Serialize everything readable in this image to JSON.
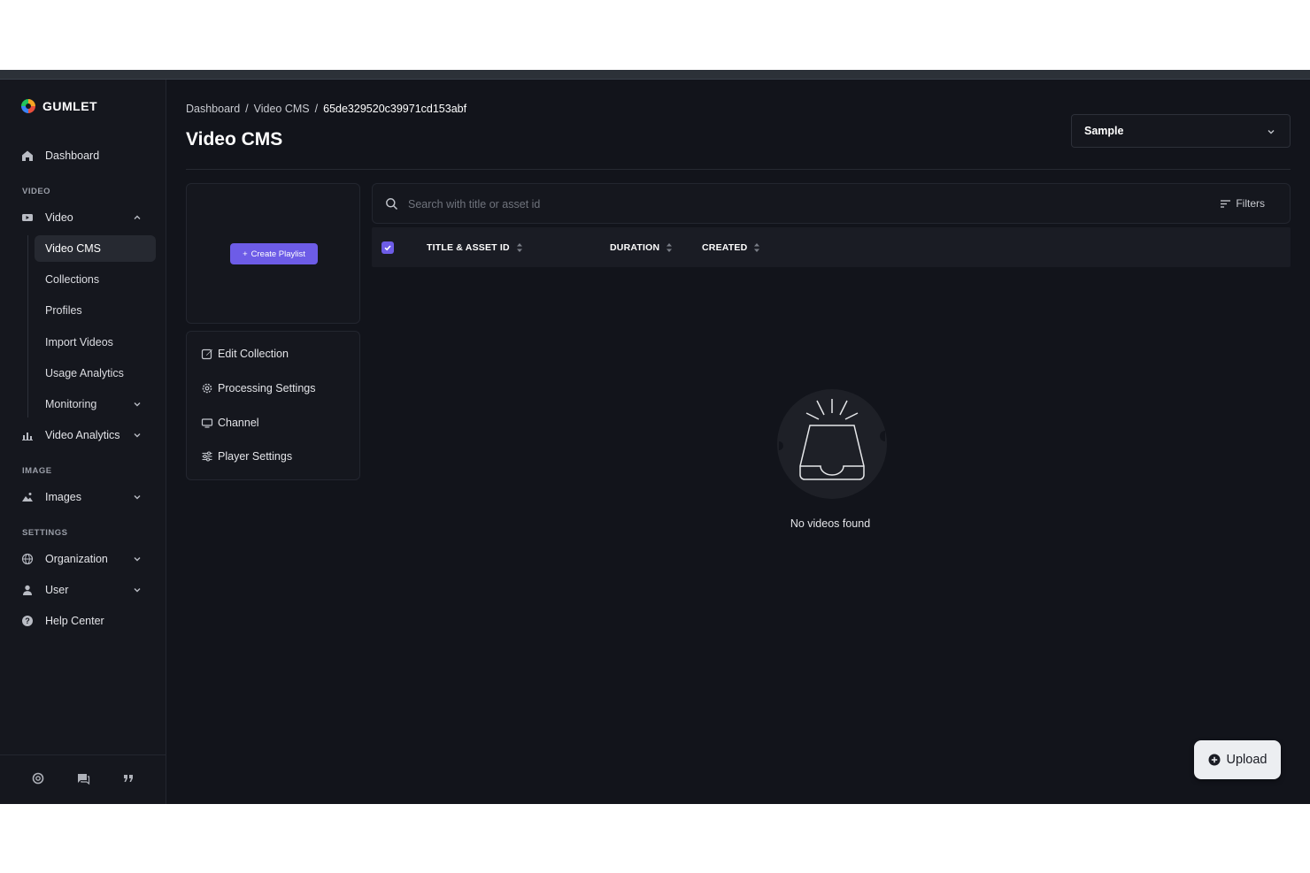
{
  "brand": {
    "name": "GUMLET"
  },
  "sidebar": {
    "dashboard": "Dashboard",
    "sections": {
      "video": "VIDEO",
      "image": "IMAGE",
      "settings": "SETTINGS"
    },
    "video": {
      "label": "Video",
      "items": [
        "Video CMS",
        "Collections",
        "Profiles",
        "Import Videos",
        "Usage Analytics",
        "Monitoring"
      ]
    },
    "video_analytics": "Video Analytics",
    "images": "Images",
    "organization": "Organization",
    "user": "User",
    "help_center": "Help Center"
  },
  "breadcrumb": {
    "home": "Dashboard",
    "section": "Video CMS",
    "current": "65de329520c39971cd153abf",
    "sep": "/"
  },
  "page": {
    "title": "Video CMS"
  },
  "collection_select": {
    "value": "Sample"
  },
  "create_playlist": {
    "label": "Create Playlist",
    "plus": "+"
  },
  "collection_menu": [
    "Edit Collection",
    "Processing Settings",
    "Channel",
    "Player Settings"
  ],
  "search": {
    "placeholder": "Search with title or asset id",
    "filters_label": "Filters"
  },
  "table": {
    "columns": [
      "TITLE & ASSET ID",
      "DURATION",
      "CREATED"
    ],
    "select_all_checked": true
  },
  "empty_state": {
    "text": "No videos found"
  },
  "upload": {
    "label": "Upload"
  },
  "colors": {
    "accent": "#6d5ce7",
    "background": "#12141b",
    "sidebar": "#15171e"
  }
}
